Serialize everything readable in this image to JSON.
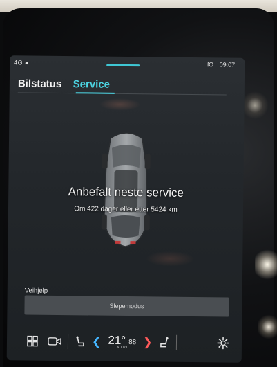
{
  "statusbar": {
    "left_icons": "4G ◂",
    "right_icon": "ſO",
    "time": "09:07"
  },
  "tabs": [
    {
      "label": "Bilstatus"
    },
    {
      "label": "Service"
    }
  ],
  "service": {
    "headline": "Anbefalt neste service",
    "detail": "Om 422 dager eller etter 5424 km"
  },
  "roadside": {
    "section_label": "Veihjelp",
    "tow_mode_label": "Slepemodus"
  },
  "climate": {
    "temperature": "21°",
    "fan_level": "88",
    "mode": "AUTO"
  },
  "colors": {
    "accent": "#4cd4e2",
    "left_arrow": "#45b6ff",
    "right_arrow": "#ff5a5a"
  }
}
